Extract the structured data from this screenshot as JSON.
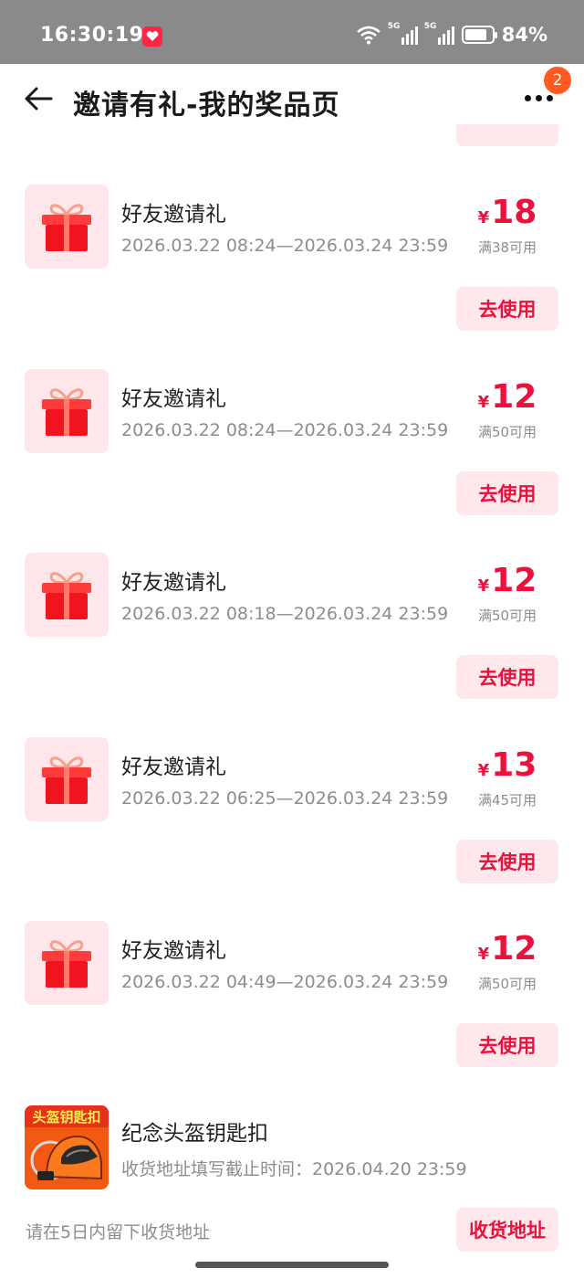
{
  "status_bar": {
    "time": "16:30:19",
    "network_label_1": "5G",
    "network_label_2": "5G",
    "battery": "84%",
    "battery_level": 0.84
  },
  "header": {
    "title": "邀请有礼-我的奖品页",
    "badge_count": "2"
  },
  "coupons": [
    {
      "title": "好友邀请礼",
      "date_range": "2026.03.22 08:24—2026.03.24 23:59",
      "currency": "¥",
      "amount": "18",
      "condition": "满38可用",
      "button_label": "去使用"
    },
    {
      "title": "好友邀请礼",
      "date_range": "2026.03.22 08:24—2026.03.24 23:59",
      "currency": "¥",
      "amount": "12",
      "condition": "满50可用",
      "button_label": "去使用"
    },
    {
      "title": "好友邀请礼",
      "date_range": "2026.03.22 08:18—2026.03.24 23:59",
      "currency": "¥",
      "amount": "12",
      "condition": "满50可用",
      "button_label": "去使用"
    },
    {
      "title": "好友邀请礼",
      "date_range": "2026.03.22 06:25—2026.03.24 23:59",
      "currency": "¥",
      "amount": "13",
      "condition": "满45可用",
      "button_label": "去使用"
    },
    {
      "title": "好友邀请礼",
      "date_range": "2026.03.22 04:49—2026.03.24 23:59",
      "currency": "¥",
      "amount": "12",
      "condition": "满50可用",
      "button_label": "去使用"
    }
  ],
  "helmet_prize": {
    "thumb_text": "头盔钥匙扣",
    "title": "纪念头盔钥匙扣",
    "deadline": "收货地址填写截止时间：2026.04.20 23:59",
    "hint": "请在5日内留下收货地址",
    "button_label": "收货地址"
  },
  "colors": {
    "accent": "#e8123c",
    "button_bg": "#ffe8ec",
    "badge": "#ff5a1f",
    "status_bar": "#8a8a8a"
  }
}
